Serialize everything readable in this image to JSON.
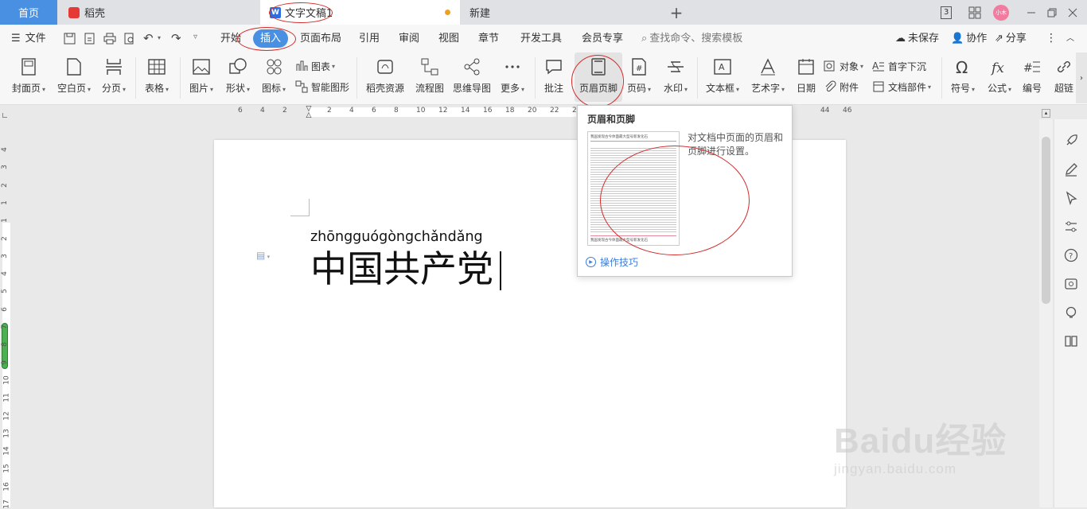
{
  "tabs": {
    "home": "首页",
    "daoke": "稻壳",
    "doc": "文字文稿1",
    "new": "新建",
    "plus": "+",
    "counter": "3"
  },
  "account": {
    "avatar_text": "小木"
  },
  "menu": {
    "file": "文件",
    "items": [
      "开始",
      "插入",
      "页面布局",
      "引用",
      "审阅",
      "视图",
      "章节",
      "开发工具",
      "会员专享"
    ],
    "search_placeholder": "查找命令、搜索模板",
    "unsaved": "未保存",
    "collab": "协作",
    "share": "分享"
  },
  "ribbon": {
    "cover": "封面页",
    "blank": "空白页",
    "pagebreak": "分页",
    "table": "表格",
    "picture": "图片",
    "shape": "形状",
    "icon": "图标",
    "chart": "图表",
    "smartart": "智能图形",
    "daoke_res": "稻壳资源",
    "flowchart": "流程图",
    "mindmap": "思维导图",
    "more": "更多",
    "comment": "批注",
    "header_footer": "页眉页脚",
    "page_number": "页码",
    "watermark": "水印",
    "textbox": "文本框",
    "wordart": "艺术字",
    "date": "日期",
    "object": "对象",
    "attachment": "附件",
    "dropcap": "首字下沉",
    "docparts": "文档部件",
    "symbol": "符号",
    "formula": "公式",
    "numbering": "编号",
    "hyperlink": "超链"
  },
  "ruler_h": [
    "6",
    "4",
    "2",
    "2",
    "4",
    "6",
    "8",
    "10",
    "12",
    "14",
    "16",
    "18",
    "20",
    "22",
    "24",
    "44",
    "46"
  ],
  "ruler_v": [
    "4",
    "3",
    "2",
    "1",
    "1",
    "2",
    "3",
    "4",
    "5",
    "6",
    "7",
    "8",
    "9",
    "10",
    "11",
    "12",
    "13",
    "14",
    "15",
    "16",
    "17"
  ],
  "document": {
    "pinyin": "zhōngguógòngchǎndǎng",
    "text": "中国共产党"
  },
  "popup": {
    "title": "页眉和页脚",
    "desc": "对文档中页面的页眉和页脚进行设置。",
    "tips": "操作技巧",
    "thumb_header": "我国发现古今体面最大型号新发化石"
  },
  "watermark": {
    "brand": "Baidu经验",
    "url": "jingyan.baidu.com"
  },
  "colors": {
    "accent": "#3b7ddd",
    "annotation": "#d42b2b",
    "active_tab": "#4a90e2"
  }
}
